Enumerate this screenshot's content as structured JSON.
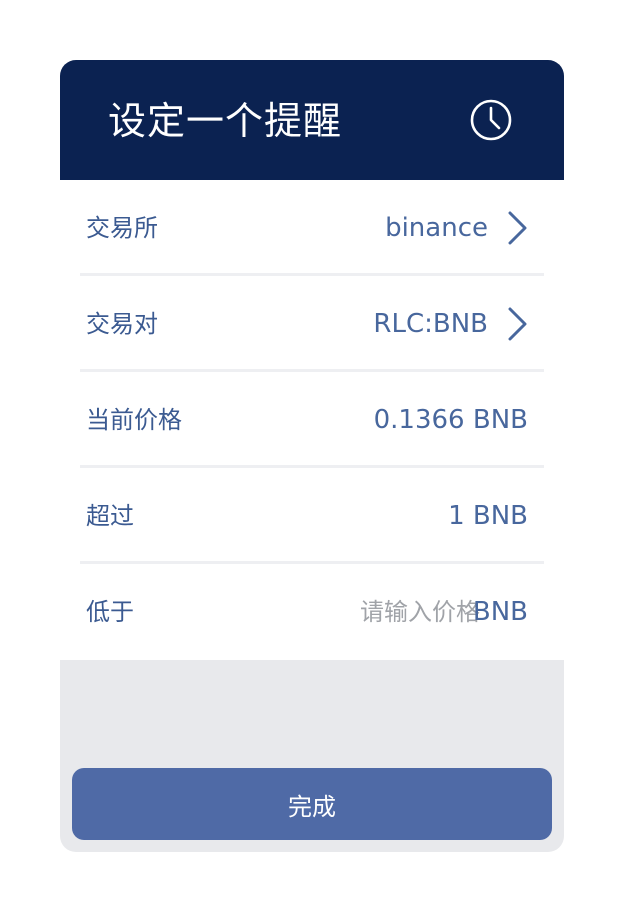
{
  "header": {
    "title": "设定一个提醒",
    "icon": "clock-icon"
  },
  "form": {
    "exchange": {
      "label": "交易所",
      "value": "binance"
    },
    "pair": {
      "label": "交易对",
      "value": "RLC:BNB"
    },
    "current_price": {
      "label": "当前价格",
      "value": "0.1366 BNB"
    },
    "above": {
      "label": "超过",
      "value": "1 BNB"
    },
    "below": {
      "label": "低于",
      "placeholder": "请输入价格",
      "unit": "BNB"
    }
  },
  "footer": {
    "done_label": "完成"
  },
  "colors": {
    "header_bg": "#0b2251",
    "label": "#3b5a91",
    "value": "#48679d",
    "button_bg": "#4f6aa6",
    "footer_bg": "#e8e9ec"
  }
}
